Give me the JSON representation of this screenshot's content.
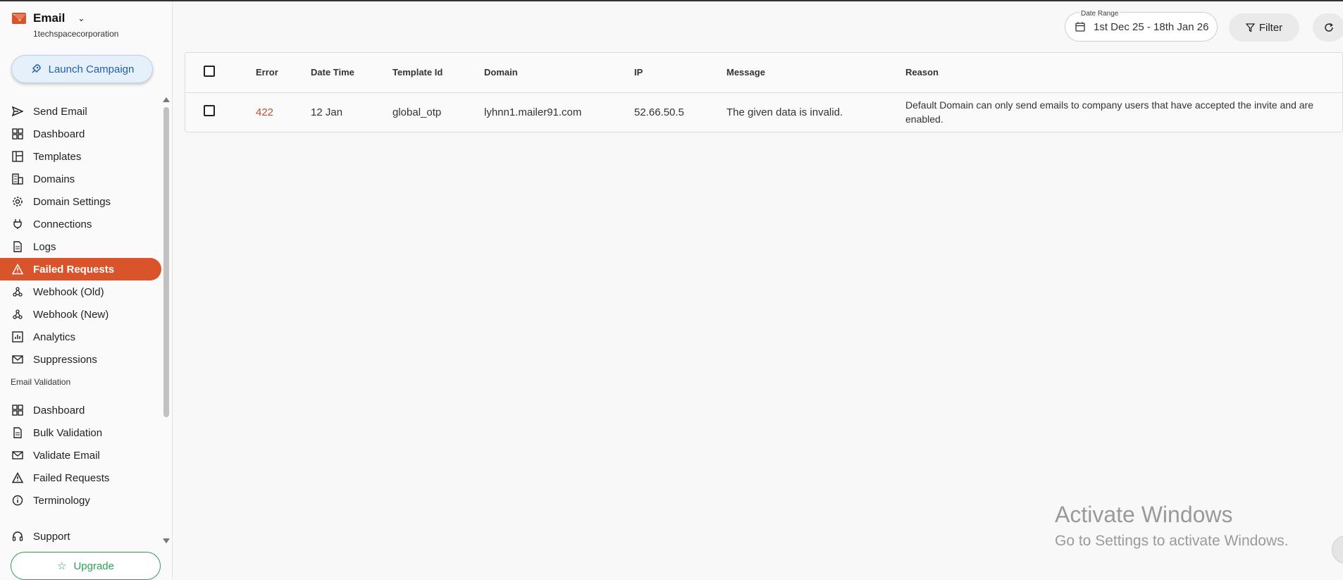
{
  "app": {
    "title": "Email",
    "org": "1techspacecorporation"
  },
  "launch_label": "Launch Campaign",
  "nav_email": [
    {
      "label": "Send Email",
      "icon": "send-icon"
    },
    {
      "label": "Dashboard",
      "icon": "dashboard-icon"
    },
    {
      "label": "Templates",
      "icon": "templates-icon"
    },
    {
      "label": "Domains",
      "icon": "building-icon"
    },
    {
      "label": "Domain Settings",
      "icon": "gear-icon"
    },
    {
      "label": "Connections",
      "icon": "plug-icon"
    },
    {
      "label": "Logs",
      "icon": "document-icon"
    },
    {
      "label": "Failed Requests",
      "icon": "warning-icon",
      "active": true
    },
    {
      "label": "Webhook (Old)",
      "icon": "webhook-icon"
    },
    {
      "label": "Webhook (New)",
      "icon": "webhook-icon"
    },
    {
      "label": "Analytics",
      "icon": "analytics-icon"
    },
    {
      "label": "Suppressions",
      "icon": "mail-block-icon"
    }
  ],
  "section_validation": "Email Validation",
  "nav_validation": [
    {
      "label": "Dashboard",
      "icon": "dashboard-icon"
    },
    {
      "label": "Bulk Validation",
      "icon": "document-icon"
    },
    {
      "label": "Validate Email",
      "icon": "mail-icon"
    },
    {
      "label": "Failed Requests",
      "icon": "warning-icon"
    },
    {
      "label": "Terminology",
      "icon": "info-icon"
    }
  ],
  "support_label": "Support",
  "upgrade_label": "Upgrade",
  "date_range": {
    "label": "Date Range",
    "value": "1st Dec 25 - 18th Jan 26"
  },
  "filter_label": "Filter",
  "table": {
    "headers": [
      "Error",
      "Date Time",
      "Template Id",
      "Domain",
      "IP",
      "Message",
      "Reason"
    ],
    "rows": [
      [
        "422",
        "12 Jan",
        "global_otp",
        "lyhnn1.mailer91.com",
        "52.66.50.5",
        "The given data is invalid.",
        "Default Domain can only send emails to company users that have accepted the invite and are enabled."
      ]
    ]
  },
  "watermark": {
    "line1": "Activate Windows",
    "line2": "Go to Settings to activate Windows."
  },
  "colors": {
    "accent": "#d9542b",
    "upgrade": "#2f9e55",
    "launch": "#1f5fa8"
  }
}
